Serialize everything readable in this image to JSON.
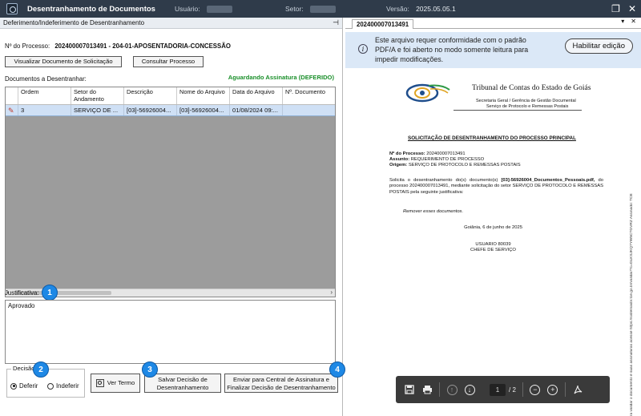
{
  "titlebar": {
    "title": "Desentranhamento de Documentos",
    "user_label": "Usuário:",
    "sector_label": "Setor:",
    "version_label": "Versão:",
    "version_value": "2025.05.05.1"
  },
  "left_panel": {
    "header": "Deferimento/Indeferimento de Desentranhamento",
    "process_label": "Nº do Processo:",
    "process_value": "202400007013491 - 204-01-APOSENTADORIA-CONCESSÃO",
    "btn_view_request": "Visualizar Documento de Solicitação",
    "btn_consult_process": "Consultar Processo",
    "documents_label": "Documentos a Desentranhar:",
    "status": "Aguardando Assinatura (DEFERIDO)",
    "grid": {
      "headers": [
        "Ordem",
        "Setor do Andamento",
        "Descrição",
        "Nome do Arquivo",
        "Data do Arquivo",
        "Nº. Documento"
      ],
      "rows": [
        [
          "3",
          "SERVIÇO DE ...",
          "[03]-56926004...",
          "[03]-56926004...",
          "01/08/2024 09:...",
          ""
        ]
      ]
    },
    "justification_label": "Justificativa:",
    "justification_value": "Aprovado",
    "decision_legend": "Decisão",
    "radio_approve": "Deferir",
    "radio_reject": "Indeferir",
    "btn_view_term": "Ver Termo",
    "btn_save_line1": "Salvar Decisão de",
    "btn_save_line2": "Desentranhamento",
    "btn_send_line1": "Enviar para Central de Assinatura e",
    "btn_send_line2": "Finalizar Decisão de Desentranhamento",
    "badges": [
      "1",
      "2",
      "3",
      "4"
    ]
  },
  "right_panel": {
    "tab": "202400007013491",
    "info_text": "Este arquivo requer conformidade com o padrão PDF/A e foi aberto no modo somente leitura para impedir modificações.",
    "enable_edit": "Habilitar edição",
    "document": {
      "org": "Tribunal de Contas do Estado de Goiás",
      "sub1": "Secretaria Geral / Gerência de Gestão Documental",
      "sub2": "Serviço de Protocolo e Remessas Postais",
      "title": "SOLICITAÇÃO DE DESENTRANHAMENTO DO PROCESSO PRINCIPAL",
      "proc_label": "Nº do Processo:",
      "proc_value": "202400007013491",
      "subject_label": "Assunto:",
      "subject_value": "REQUERIMENTO DE PROCESSO",
      "origin_label": "Origem:",
      "origin_value": "SERVIÇO DE PROTOCOLO E REMESSAS POSTAIS",
      "para_start": "Solicita o desentranhamento do(s) documento(s)",
      "para_bold": "[03]-56926004_Documentos_Pessoais.pdf,",
      "para_end": "do processo 202400007013491, mediante solicitação do setor SERVIÇO DE PROTOCOLO E REMESSAS POSTAIS pela seguinte justificativa:",
      "instruction": "Remover esses documentos.",
      "date_place": "Goiânia, 6 de junho de 2025",
      "signer": "USUARIO 80039",
      "role": "CHEFE DE SERVIÇO",
      "side_text": "Para validar o documento e suas assinaturas acesse https://sistemasbr.tce.go.br/validar/?c=GLKSJKQ7YW5CTGVRZ Assinado: TCE"
    },
    "pdf_toolbar": {
      "page_current": "1",
      "page_total": "/ 2"
    }
  }
}
